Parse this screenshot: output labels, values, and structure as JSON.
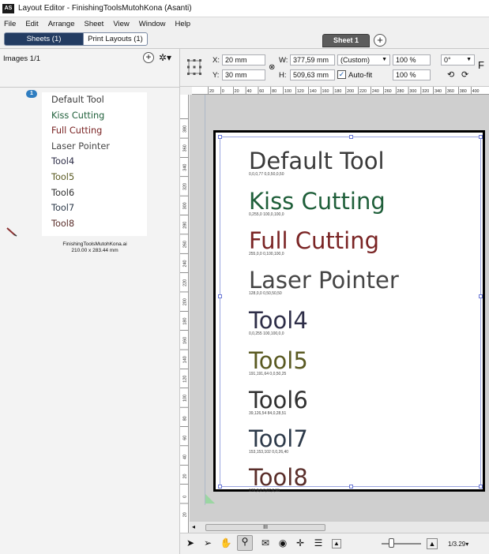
{
  "window": {
    "title": "Layout Editor - FinishingToolsMutohKona (Asanti)",
    "logo": "AS"
  },
  "menu": [
    "File",
    "Edit",
    "Arrange",
    "Sheet",
    "View",
    "Window",
    "Help"
  ],
  "tabs": {
    "sheets": "Sheets (1)",
    "print_layouts": "Print Layouts (1)",
    "sheet1": "Sheet 1",
    "add": "+"
  },
  "left_panel": {
    "images_count": "Images 1/1",
    "add_label": "+",
    "gear_label": "✲▾",
    "thumb_badge": "1",
    "thumbnail_items": [
      {
        "text": "Default Tool",
        "color": "#3a3a3a"
      },
      {
        "text": "Kiss Cutting",
        "color": "#1f5f3a"
      },
      {
        "text": "Full Cutting",
        "color": "#7a2424"
      },
      {
        "text": "Laser Pointer",
        "color": "#454545"
      },
      {
        "text": "Tool4",
        "color": "#2e2e48"
      },
      {
        "text": "Tool5",
        "color": "#5a5a22"
      },
      {
        "text": "Tool6",
        "color": "#303030"
      },
      {
        "text": "Tool7",
        "color": "#2d3a4a"
      },
      {
        "text": "Tool8",
        "color": "#5a2e2a"
      }
    ],
    "file_name": "FinishingToolsMutohKona.ai",
    "file_size": "210.00 x 283.44 mm"
  },
  "toolbar": {
    "x_label": "X:",
    "x_value": "20 mm",
    "y_label": "Y:",
    "y_value": "30 mm",
    "w_label": "W:",
    "w_value": "377,59 mm",
    "h_label": "H:",
    "h_value": "509,63 mm",
    "size_mode": "(Custom)",
    "autofit_label": "Auto-fit",
    "autofit_checked": true,
    "scale_w": "100 %",
    "scale_h": "100 %",
    "rotation": "0°",
    "flip_label": "F"
  },
  "rulers": {
    "h_ticks": [
      "20",
      "0",
      "20",
      "40",
      "60",
      "80",
      "100",
      "120",
      "140",
      "160",
      "180",
      "200",
      "220",
      "240",
      "260",
      "280",
      "300",
      "320",
      "340",
      "360",
      "380",
      "400"
    ],
    "v_ticks": [
      "380",
      "360",
      "340",
      "320",
      "300",
      "280",
      "260",
      "240",
      "220",
      "200",
      "180",
      "160",
      "140",
      "120",
      "100",
      "80",
      "60",
      "40",
      "20",
      "0",
      "20"
    ]
  },
  "page_items": [
    {
      "text": "Default Tool",
      "color": "#3a3a3a",
      "caption": "0,0,0,77    0,0,50,0,50"
    },
    {
      "text": "Kiss Cutting",
      "color": "#1f5f3a",
      "caption": "0,255,0    100,0,100,0"
    },
    {
      "text": "Full Cutting",
      "color": "#7a2424",
      "caption": "255,0,0    0,100,100,0"
    },
    {
      "text": "Laser Pointer",
      "color": "#454545",
      "caption": "128,0,0    0,50,50,50"
    },
    {
      "text": "Tool4",
      "color": "#2e2e48",
      "caption": "0,0,255    100,100,0,0"
    },
    {
      "text": "Tool5",
      "color": "#5a5a22",
      "caption": "191,191,64    0,0,50,25"
    },
    {
      "text": "Tool6",
      "color": "#303030",
      "caption": "39,126,54    84,0,28,51"
    },
    {
      "text": "Tool7",
      "color": "#2d3a4a",
      "caption": "153,153,102    0,0,26,40"
    },
    {
      "text": "Tool8",
      "color": "#5a2e2a",
      "caption": "170,0,0    0,67,6,55"
    }
  ],
  "status": {
    "zoom": "1/3.29▾",
    "scroll_mark": "III",
    "scroll_left": "◂"
  }
}
